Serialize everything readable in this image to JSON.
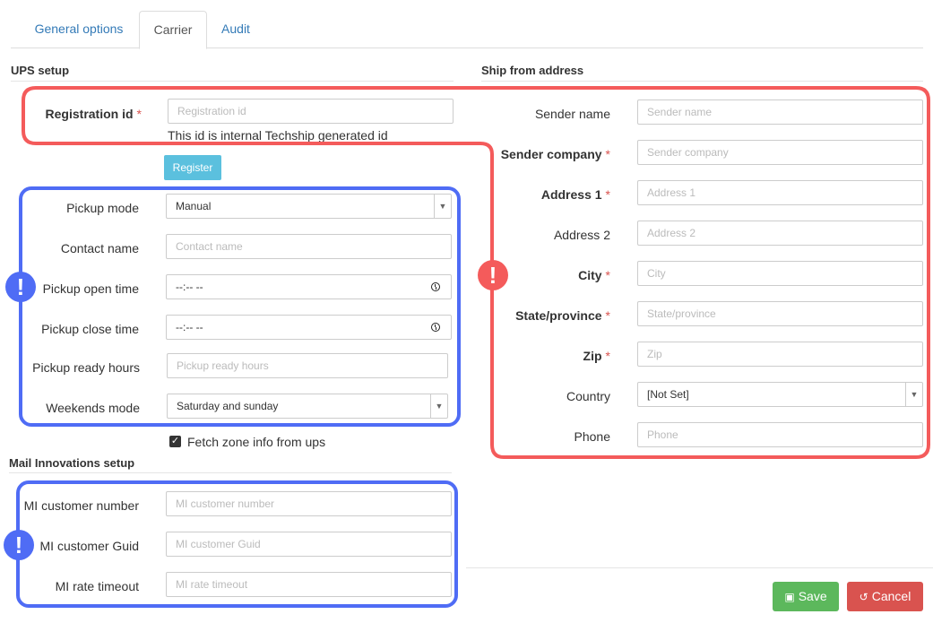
{
  "tabs": [
    {
      "label": "General options",
      "active": false
    },
    {
      "label": "Carrier",
      "active": true
    },
    {
      "label": "Audit",
      "active": false
    }
  ],
  "ups_setup": {
    "title": "UPS setup",
    "registration_id": {
      "label": "Registration id",
      "required": "*",
      "placeholder": "Registration id",
      "hint": "This id is internal Techship generated id"
    },
    "register_button": "Register",
    "pickup_mode": {
      "label": "Pickup mode",
      "value": "Manual"
    },
    "contact_name": {
      "label": "Contact name",
      "placeholder": "Contact name"
    },
    "pickup_open_time": {
      "label": "Pickup open time",
      "value": "--:-- --"
    },
    "pickup_close_time": {
      "label": "Pickup close time",
      "value": "--:-- --"
    },
    "pickup_ready_hours": {
      "label": "Pickup ready hours",
      "placeholder": "Pickup ready hours"
    },
    "weekends_mode": {
      "label": "Weekends mode",
      "value": "Saturday and sunday"
    },
    "fetch_zone": {
      "label": "Fetch zone info from ups",
      "checked": true
    }
  },
  "mail_innovations": {
    "title": "Mail Innovations setup",
    "customer_number": {
      "label": "MI customer number",
      "placeholder": "MI customer number"
    },
    "customer_guid": {
      "label": "MI customer Guid",
      "placeholder": "MI customer Guid"
    },
    "rate_timeout": {
      "label": "MI rate timeout",
      "placeholder": "MI rate timeout"
    }
  },
  "ship_from": {
    "title": "Ship from address",
    "sender_name": {
      "label": "Sender name",
      "placeholder": "Sender name"
    },
    "sender_company": {
      "label": "Sender company",
      "required": "*",
      "placeholder": "Sender company"
    },
    "address1": {
      "label": "Address 1",
      "required": "*",
      "placeholder": "Address 1"
    },
    "address2": {
      "label": "Address 2",
      "placeholder": "Address 2"
    },
    "city": {
      "label": "City",
      "required": "*",
      "placeholder": "City"
    },
    "state": {
      "label": "State/province",
      "required": "*",
      "placeholder": "State/province"
    },
    "zip": {
      "label": "Zip",
      "required": "*",
      "placeholder": "Zip"
    },
    "country": {
      "label": "Country",
      "value": "[Not Set]"
    },
    "phone": {
      "label": "Phone",
      "placeholder": "Phone"
    }
  },
  "actions": {
    "save": "Save",
    "cancel": "Cancel"
  },
  "alert_glyph": "!",
  "colors": {
    "accent_red": "#f45b5b",
    "accent_blue": "#4f6cf5",
    "save": "#5cb85c",
    "cancel": "#d9534f",
    "register": "#5bc0de"
  }
}
